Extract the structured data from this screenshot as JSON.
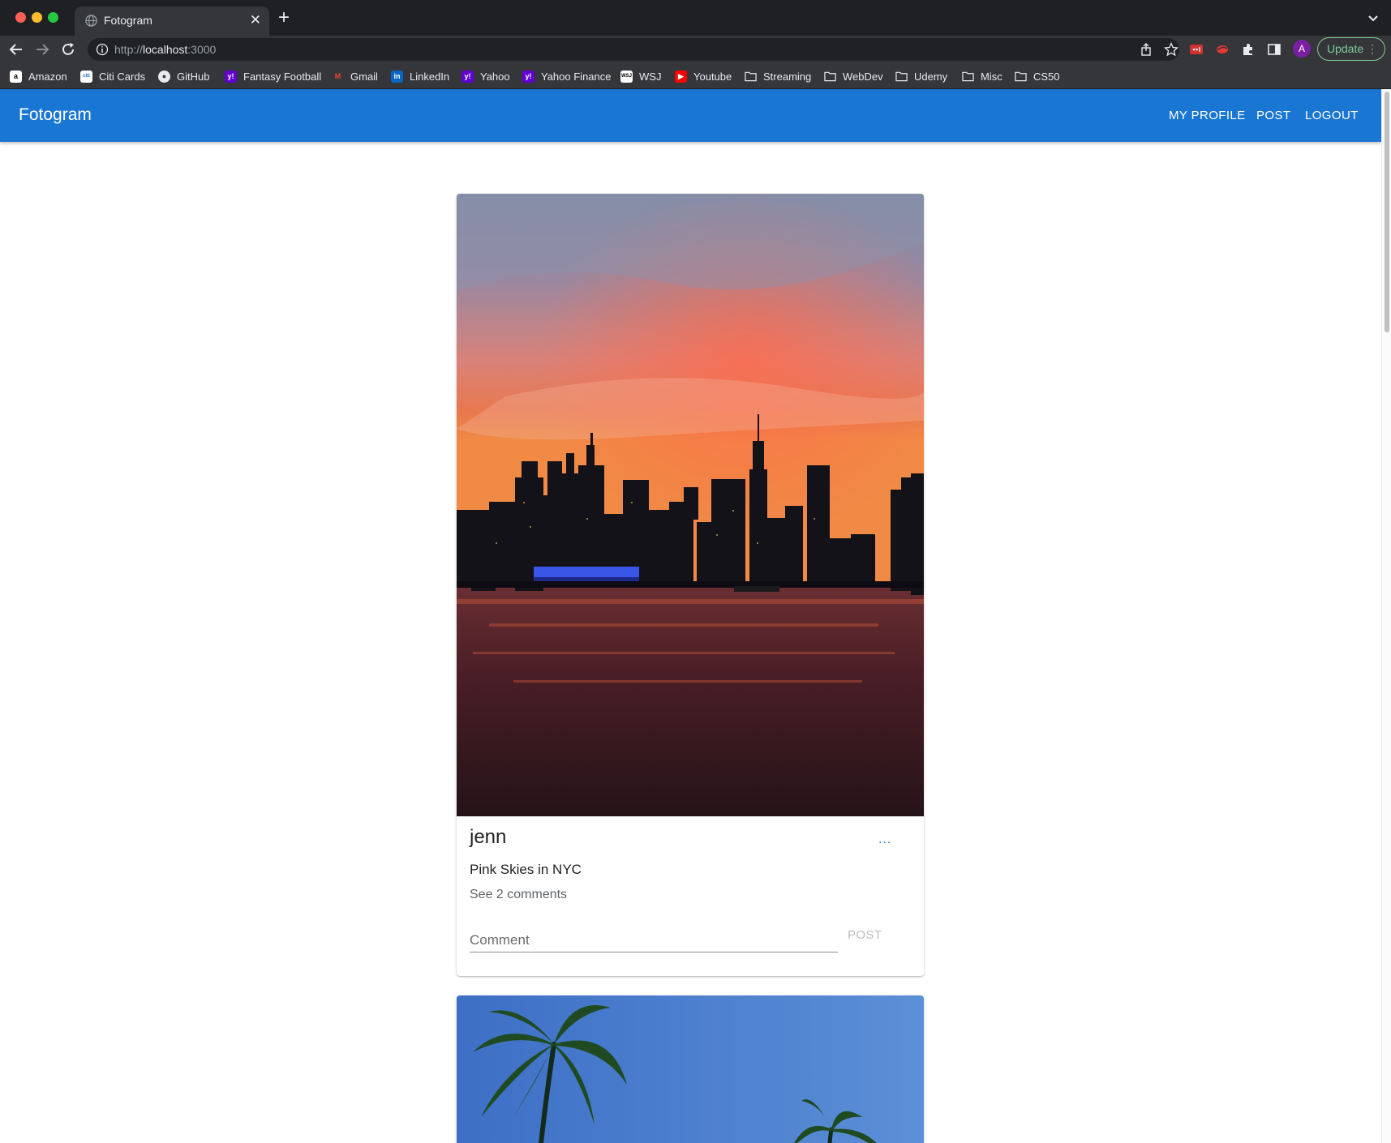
{
  "browser": {
    "tab": {
      "title": "Fotogram"
    },
    "url": {
      "scheme": "http://",
      "host": "localhost",
      "port": ":3000"
    },
    "profile_initial": "A",
    "update_label": "Update",
    "bookmarks": [
      {
        "label": "Amazon",
        "icon": "amazon-icon"
      },
      {
        "label": "Citi Cards",
        "icon": "citi-icon"
      },
      {
        "label": "GitHub",
        "icon": "github-icon"
      },
      {
        "label": "Fantasy Football",
        "icon": "yahoo-icon"
      },
      {
        "label": "Gmail",
        "icon": "gmail-icon"
      },
      {
        "label": "LinkedIn",
        "icon": "linkedin-icon"
      },
      {
        "label": "Yahoo",
        "icon": "yahoo-icon"
      },
      {
        "label": "Yahoo Finance",
        "icon": "yahoo-icon"
      },
      {
        "label": "WSJ",
        "icon": "wsj-icon"
      },
      {
        "label": "Youtube",
        "icon": "youtube-icon"
      },
      {
        "label": "Streaming",
        "icon": "folder-icon"
      },
      {
        "label": "WebDev",
        "icon": "folder-icon"
      },
      {
        "label": "Udemy",
        "icon": "folder-icon"
      },
      {
        "label": "Misc",
        "icon": "folder-icon"
      },
      {
        "label": "CS50",
        "icon": "folder-icon"
      }
    ]
  },
  "app": {
    "brand": "Fotogram",
    "nav": {
      "profile": "MY PROFILE",
      "post": "POST",
      "logout": "LOGOUT"
    }
  },
  "posts": [
    {
      "username": "jenn",
      "caption": "Pink Skies in NYC",
      "comments_link": "See 2 comments",
      "more_label": "...",
      "comment_placeholder": "Comment",
      "post_label": "POST"
    }
  ],
  "colors": {
    "appbar": "#1976d2",
    "chrome_dark": "#1f2023",
    "chrome_toolbar": "#35363a"
  }
}
